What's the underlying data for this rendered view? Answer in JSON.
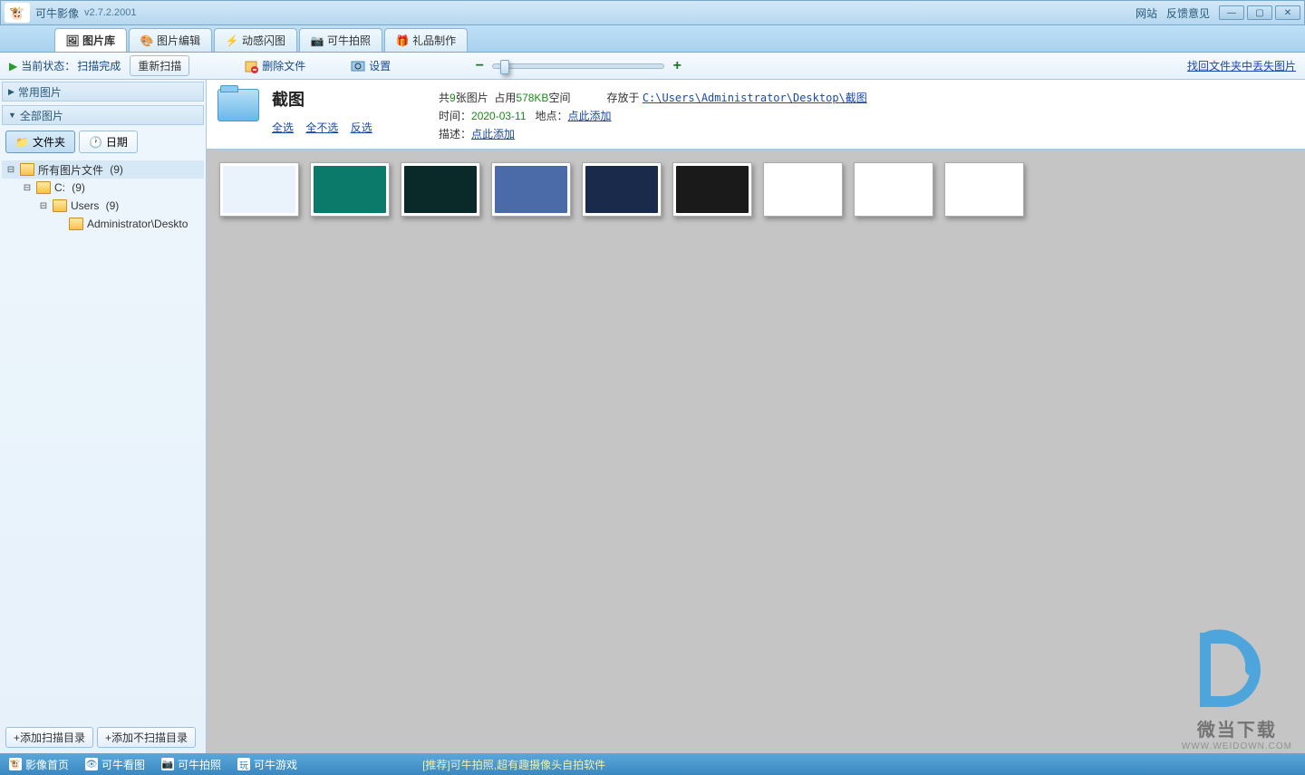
{
  "title": {
    "app": "可牛影像",
    "version": "v2.7.2.2001"
  },
  "titlebar_links": {
    "site": "网站",
    "feedback": "反馈意见"
  },
  "tabs": {
    "library": "图片库",
    "edit": "图片编辑",
    "flash": "动感闪图",
    "camera": "可牛拍照",
    "gift": "礼品制作"
  },
  "toolbar": {
    "status_label": "当前状态：",
    "status_value": "扫描完成",
    "rescan": "重新扫描",
    "delete": "删除文件",
    "settings": "设置",
    "find_lost": "找回文件夹中丢失图片"
  },
  "sidebar": {
    "common": "常用图片",
    "all": "全部图片",
    "tab_folder": "文件夹",
    "tab_date": "日期",
    "tree": {
      "root": "所有图片文件",
      "root_count": "(9)",
      "c": "C:",
      "c_count": "(9)",
      "users": "Users",
      "users_count": "(9)",
      "admin": "Administrator\\Deskto"
    },
    "add_scan": "+添加扫描目录",
    "add_noscan": "+添加不扫描目录"
  },
  "info": {
    "title": "截图",
    "count_pre": "共",
    "count": "9",
    "count_suf": "张图片",
    "size_pre": "占用",
    "size": "578KB",
    "size_suf": "空间",
    "path_pre": "存放于",
    "path": "C:\\Users\\Administrator\\Desktop\\截图",
    "time_label": "时间：",
    "time": "2020-03-11",
    "place_label": "地点：",
    "place_add": "点此添加",
    "desc_label": "描述：",
    "desc_add": "点此添加",
    "sel_all": "全选",
    "sel_none": "全不选",
    "sel_inv": "反选"
  },
  "thumbs": [
    {
      "bg": "#eaf2fb"
    },
    {
      "bg": "#0c7a6a"
    },
    {
      "bg": "#0a2a2a"
    },
    {
      "bg": "#4a6aa8"
    },
    {
      "bg": "#1a2a4a"
    },
    {
      "bg": "#1a1a1a"
    },
    {
      "bg": "#ffffff"
    },
    {
      "bg": "#ffffff"
    },
    {
      "bg": "#ffffff"
    }
  ],
  "statusbar": {
    "home": "影像首页",
    "view": "可牛看图",
    "cam": "可牛拍照",
    "game": "可牛游戏",
    "promo": "[推荐]可牛拍照,超有趣摄像头自拍软件"
  },
  "watermark": {
    "name": "微当下载",
    "url": "WWW.WEIDOWN.COM"
  }
}
